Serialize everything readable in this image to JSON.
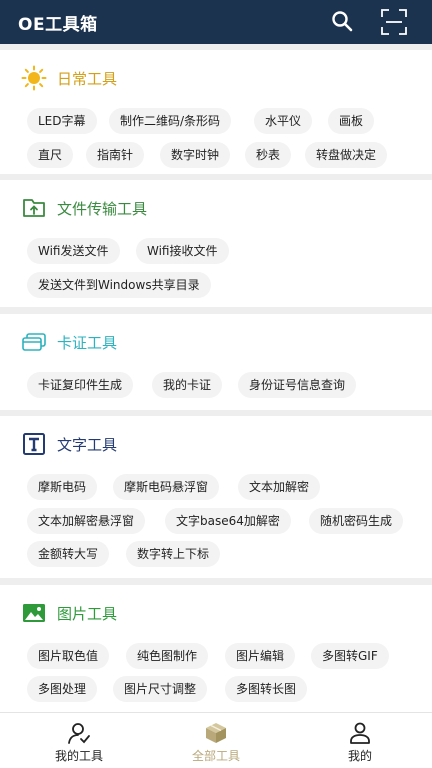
{
  "header": {
    "title": "OE工具箱"
  },
  "sections": [
    {
      "title": "日常工具",
      "title_color": "#d4a017",
      "icon": "sun-icon",
      "items": [
        "LED字幕",
        "制作二维码/条形码",
        "水平仪",
        "画板",
        "直尺",
        "指南针",
        "数字时钟",
        "秒表",
        "转盘做决定"
      ]
    },
    {
      "title": "文件传输工具",
      "title_color": "#3a8a3f",
      "icon": "file-transfer-icon",
      "items": [
        "Wifi发送文件",
        "Wifi接收文件",
        "发送文件到Windows共享目录"
      ]
    },
    {
      "title": "卡证工具",
      "title_color": "#2bb3c0",
      "icon": "id-card-icon",
      "items": [
        "卡证复印件生成",
        "我的卡证",
        "身份证号信息查询"
      ]
    },
    {
      "title": "文字工具",
      "title_color": "#233a73",
      "icon": "text-icon",
      "items": [
        "摩斯电码",
        "摩斯电码悬浮窗",
        "文本加解密",
        "文本加解密悬浮窗",
        "文字base64加解密",
        "随机密码生成",
        "金额转大写",
        "数字转上下标"
      ]
    },
    {
      "title": "图片工具",
      "title_color": "#2e9a3a",
      "icon": "image-icon",
      "items": [
        "图片取色值",
        "纯色图制作",
        "图片编辑",
        "多图转GIF",
        "多图处理",
        "图片尺寸调整",
        "多图转长图"
      ]
    }
  ],
  "bottom_nav": [
    {
      "label": "我的工具",
      "icon": "user-tools-icon",
      "active": false
    },
    {
      "label": "全部工具",
      "icon": "box-icon",
      "active": true
    },
    {
      "label": "我的",
      "icon": "user-icon",
      "active": false
    }
  ],
  "colors": {
    "header_bg": "#1c3350",
    "active_nav": "#b8a87a",
    "chip_bg": "#f3f3f3"
  }
}
